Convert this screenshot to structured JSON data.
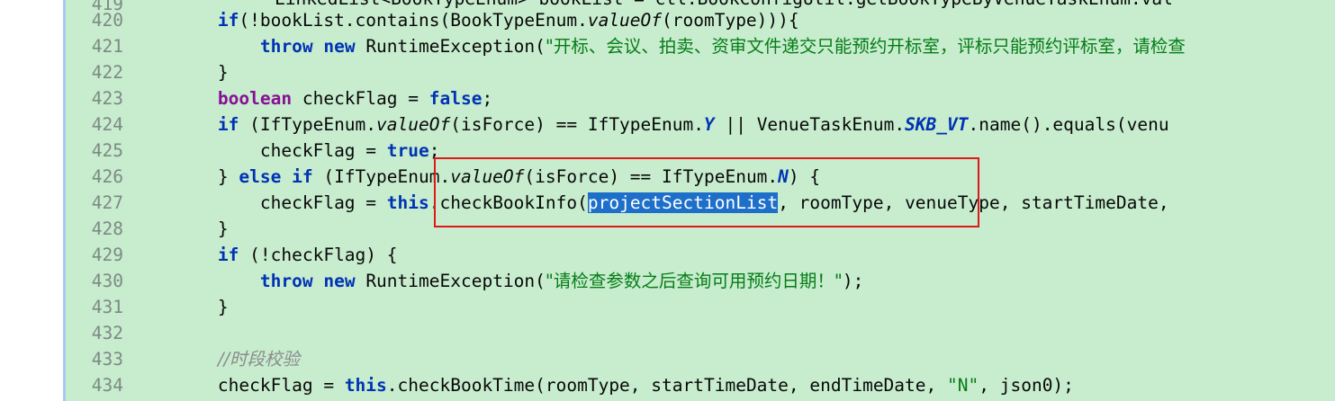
{
  "editor": {
    "background_color": "#c7ecce",
    "selection_color": "#1d6fc9",
    "annotation_box_color": "#e01818",
    "partial_top_line": "LinkedList<BookTypeEnum> bookList = ctl.BookConfigUtil.getBookTypeByVenueTaskEnum.val",
    "lines": [
      {
        "num": "420",
        "indent": "        ",
        "p1": "if",
        "p2": "(!bookList.contains(BookTypeEnum.",
        "p3": "valueOf",
        "p4": "(roomType))){"
      },
      {
        "num": "421",
        "indent": "            ",
        "p1": "throw",
        "p2": " ",
        "p3": "new",
        "p4": " RuntimeException(",
        "s1": "\"开标、会议、拍卖、资审文件递交只能预约开标室，评标只能预约评标室，请检查"
      },
      {
        "num": "422",
        "indent": "        ",
        "p1": "}"
      },
      {
        "num": "423",
        "indent": "        ",
        "p1": "boolean",
        "p2": " checkFlag = ",
        "p3": "false",
        "p4": ";"
      },
      {
        "num": "424",
        "indent": "        ",
        "p1": "if",
        "p2": " (IfTypeEnum.",
        "p3": "valueOf",
        "p4": "(isForce) == IfTypeEnum.",
        "p5": "Y",
        "p6": " || VenueTaskEnum.",
        "p7": "SKB_VT",
        "p8": ".name().equals(venu"
      },
      {
        "num": "425",
        "indent": "            ",
        "p1": "checkFlag = ",
        "p2": "true",
        "p3": ";"
      },
      {
        "num": "426",
        "indent": "        ",
        "p1": "} ",
        "p2": "else if",
        "p3": " (IfTypeEnum.",
        "p4": "valueOf",
        "p5": "(isForce) == IfTypeEnum.",
        "p6": "N",
        "p7": ") {"
      },
      {
        "num": "427",
        "indent": "            ",
        "p1": "checkFlag = ",
        "p2": "this",
        "p3": ".checkBookInfo(",
        "p4": "projectSectionList",
        "p5": ", roomType, venueType, startTimeDate,"
      },
      {
        "num": "428",
        "indent": "        ",
        "p1": "}"
      },
      {
        "num": "429",
        "indent": "        ",
        "p1": "if",
        "p2": " (!checkFlag) {"
      },
      {
        "num": "430",
        "indent": "            ",
        "p1": "throw",
        "p2": " ",
        "p3": "new",
        "p4": " RuntimeException(",
        "s1": "\"请检查参数之后查询可用预约日期！\"",
        "p5": ");"
      },
      {
        "num": "431",
        "indent": "        ",
        "p1": "}"
      },
      {
        "num": "432",
        "indent": ""
      },
      {
        "num": "433",
        "indent": "        ",
        "c1": "//时段校验"
      },
      {
        "num": "434",
        "indent": "        ",
        "p1": "checkFlag = ",
        "p2": "this",
        "p3": ".checkBookTime(roomType, startTimeDate, endTimeDate, ",
        "s1": "\"N\"",
        "p4": ", json0);"
      }
    ]
  }
}
